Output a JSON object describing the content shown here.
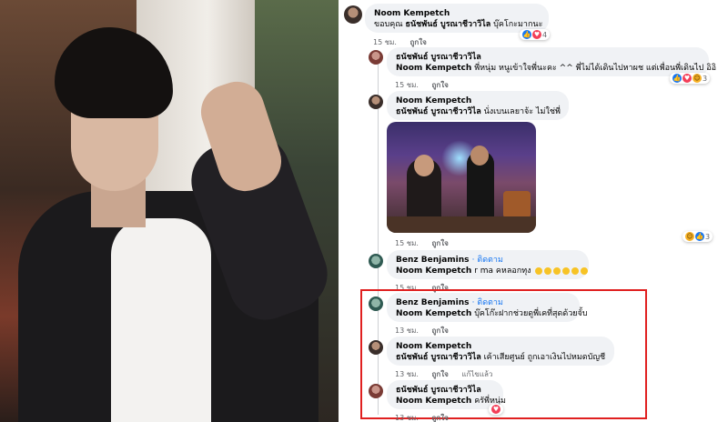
{
  "comments": [
    {
      "id": "c1",
      "author": "Noom Kempetch",
      "text_prefix": "ขอบคุณ",
      "text_mention": "ธนัชพันธ์ บูรณาชีวาวิไล",
      "text_suffix": "บุ๊คโกะมากนะ",
      "time": "15 ชม.",
      "like": "ถูกใจ",
      "reaction_count": "4"
    },
    {
      "id": "c2",
      "author": "ธนัชพันธ์ บูรณาชีวาวิไล",
      "text_mention": "Noom Kempetch",
      "text_suffix": "พี่หนุ่ม หนูเข้าใจพี่นะคะ ^^ พี่ไม่ได้เดินไปหาผช แต่เพื่อนพี่เดินไป อิอิ",
      "time": "15 ชม.",
      "like": "ถูกใจ",
      "reaction_count": "3"
    },
    {
      "id": "c3",
      "author": "Noom Kempetch",
      "text_mention": "ธนัชพันธ์ บูรณาชีวาวิไล",
      "text_suffix": "นั่งเบนเลยาจ้ะ ไม่ใช่พี่",
      "time": "15 ชม.",
      "like": "ถูกใจ",
      "reaction_count": "3"
    },
    {
      "id": "c4",
      "author": "Benz Benjamins",
      "follow": "· ติดตาม",
      "text_mention": "Noom Kempetch",
      "text_suffix": "r ma คหลอกทุง",
      "time": "15 ชม.",
      "like": "ถูกใจ"
    },
    {
      "id": "c5",
      "author": "Benz Benjamins",
      "follow": "· ติดตาม",
      "text_mention": "Noom Kempetch",
      "text_suffix": "บุ๊คโก๊ะฝากช่วยดูพี่เคที่สุดด้วยจั้บ",
      "time": "13 ชม.",
      "like": "ถูกใจ"
    },
    {
      "id": "c6",
      "author": "Noom Kempetch",
      "text_mention": "ธนัชพันธ์ บูรณาชีวาวิไล",
      "text_suffix": "เค้าเสียศูนย์ ถูกเอาเงินไปหมดบัญชี",
      "time": "13 ชม.",
      "like": "ถูกใจ",
      "edited": "แก้ไขแล้ว"
    },
    {
      "id": "c7",
      "author": "ธนัชพันธ์ บูรณาชีวาวิไล",
      "text_mention": "Noom Kempetch",
      "text_suffix": "ครัพี่หนุ่ม",
      "time": "13 ชม.",
      "like": "ถูกใจ"
    }
  ],
  "colors": {
    "link": "#1877f2",
    "highlight_border": "#e02020",
    "bubble": "#f0f2f5",
    "meta": "#65676b"
  },
  "icons": [
    "like-reaction-icon",
    "love-reaction-icon",
    "haha-reaction-icon",
    "emoji-icon"
  ]
}
